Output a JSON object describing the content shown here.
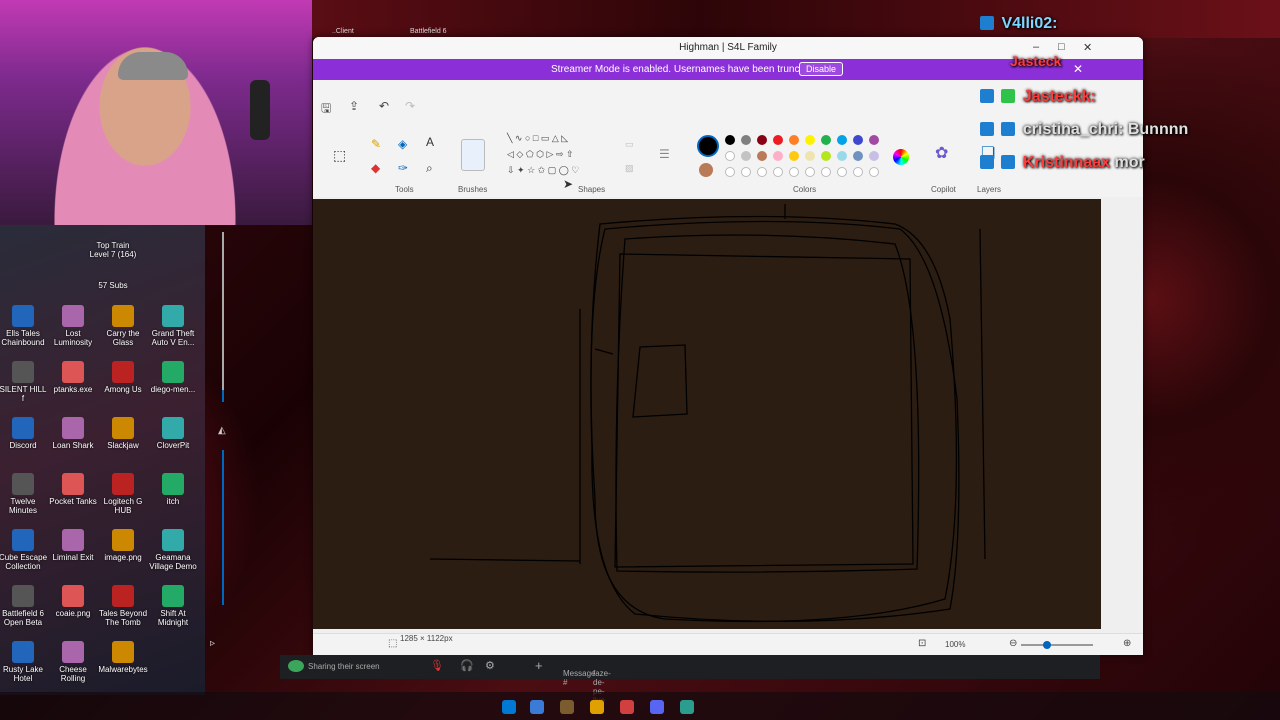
{
  "window": {
    "title": "Highman | S4L Family",
    "controls": [
      "–",
      "□",
      "✕"
    ]
  },
  "streamer_banner": {
    "message": "Streamer Mode is enabled. Usernames have been truncated.",
    "button": "Disable"
  },
  "top_apps": [
    {
      "label": "..Client"
    },
    {
      "label": "Battlefield 6"
    }
  ],
  "ribbon": {
    "groups": [
      {
        "label": "Tools"
      },
      {
        "label": "Brushes"
      },
      {
        "label": "Shapes"
      },
      {
        "label": "Colors"
      },
      {
        "label": "Copilot"
      },
      {
        "label": "Layers"
      }
    ],
    "colors": {
      "row1": [
        "#000000",
        "#7f7f7f",
        "#880015",
        "#ed1c24",
        "#ff7f27",
        "#fff200",
        "#22b14c",
        "#00a2e8",
        "#3f48cc",
        "#a349a4"
      ],
      "row2": [
        "#ffffff",
        "#c3c3c3",
        "#b97a57",
        "#ffaec9",
        "#ffc90e",
        "#efe4b0",
        "#b5e61d",
        "#99d9ea",
        "#7092be",
        "#c8bfe7"
      ],
      "row3": [
        "#ffffff",
        "#ffffff",
        "#ffffff",
        "#ffffff",
        "#ffffff",
        "#ffffff",
        "#ffffff",
        "#ffffff",
        "#ffffff",
        "#ffffff"
      ],
      "primary": "#000000",
      "secondary": "#b97a57"
    }
  },
  "canvas": {
    "background": "#2c1d12"
  },
  "status": {
    "dimensions": "1285 × 1122px",
    "zoom": "100%"
  },
  "chat": [
    {
      "user": "V4lli02:",
      "color": "#7fd7ff"
    },
    {
      "user": "Jasteck",
      "color": "#ff3b3b"
    },
    {
      "user": "Jasteckk:",
      "color": "#ff3b3b"
    },
    {
      "user": "cristina_chri: Bunnnn",
      "color": "#e0e0e0"
    },
    {
      "user": "Kristinnaax",
      "message": "mor",
      "color": "#7fd7ff"
    }
  ],
  "desktop_icons": [
    {
      "label": "Top Train Level 7 (164)"
    },
    {
      "label": "57 Subs"
    },
    {
      "label": "Ells Tales Chainbound"
    },
    {
      "label": "Lost Luminosity"
    },
    {
      "label": "Carry the Glass"
    },
    {
      "label": "Grand Theft Auto V En..."
    },
    {
      "label": "SILENT HILL f"
    },
    {
      "label": "ptanks.exe"
    },
    {
      "label": "Among Us"
    },
    {
      "label": "diego-men..."
    },
    {
      "label": "Discord"
    },
    {
      "label": "Loan Shark"
    },
    {
      "label": "Slackjaw"
    },
    {
      "label": "CloverPit"
    },
    {
      "label": "Twelve Minutes"
    },
    {
      "label": "Pocket Tanks"
    },
    {
      "label": "Logitech G HUB"
    },
    {
      "label": "itch"
    },
    {
      "label": "Cube Escape Collection"
    },
    {
      "label": "Liminal Exit"
    },
    {
      "label": "image.png"
    },
    {
      "label": "Geamana Village Demo"
    },
    {
      "label": "Battlefield 6 Open Beta"
    },
    {
      "label": "coaie.png"
    },
    {
      "label": "Tales Beyond The Tomb"
    },
    {
      "label": "Shift At Midnight"
    },
    {
      "label": "Rusty Lake Hotel"
    },
    {
      "label": "Cheese Rolling"
    },
    {
      "label": "Malwarebytes"
    }
  ],
  "discord": {
    "sharing": "Sharing their screen",
    "message_placeholder": "Message #",
    "channel": "faze-de-pe-live"
  }
}
